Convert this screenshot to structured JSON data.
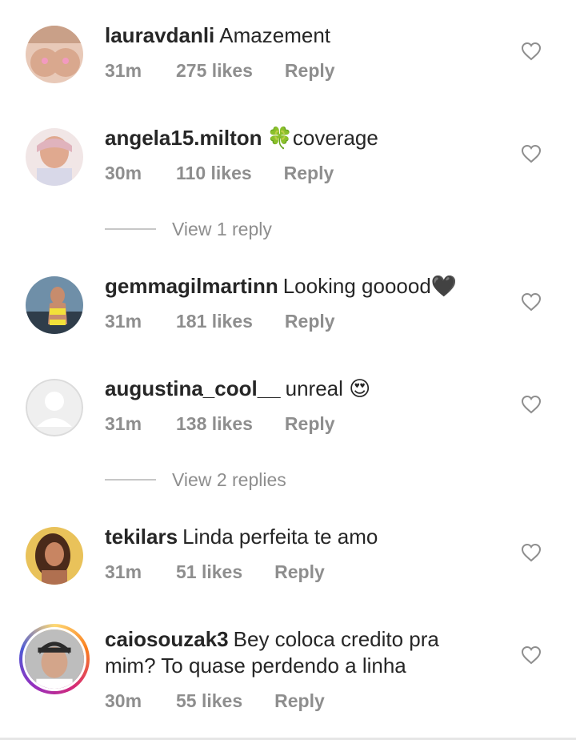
{
  "comments": [
    {
      "username": "lauravdanli",
      "text": "Amazement",
      "time": "31m",
      "likes": "275 likes",
      "reply": "Reply",
      "avatar": "avatar-photo"
    },
    {
      "username": "angela15.milton",
      "text": "🍀coverage",
      "time": "30m",
      "likes": "110 likes",
      "reply": "Reply",
      "avatar": "avatar-photo"
    },
    {
      "username": "gemmagilmartinn",
      "text": "Looking gooood🖤",
      "time": "31m",
      "likes": "181 likes",
      "reply": "Reply",
      "avatar": "avatar-photo"
    },
    {
      "username": "augustina_cool__",
      "text": "unreal 😍",
      "time": "31m",
      "likes": "138 likes",
      "reply": "Reply",
      "avatar": "default-avatar"
    },
    {
      "username": "tekilars",
      "text": "Linda perfeita te amo",
      "time": "31m",
      "likes": "51 likes",
      "reply": "Reply",
      "avatar": "avatar-photo"
    },
    {
      "username": "caiosouzak3",
      "text": "Bey coloca credito pra mim? To quase perdendo a linha",
      "time": "30m",
      "likes": "55 likes",
      "reply": "Reply",
      "avatar": "avatar-photo-story-ring"
    }
  ],
  "view_replies": [
    {
      "label": "View 1 reply"
    },
    {
      "label": "View 2 replies"
    }
  ],
  "icons": {
    "like": "heart-outline-icon"
  },
  "colors": {
    "text": "#262626",
    "secondary": "#8e8e8e",
    "divider": "#c7c7c7"
  }
}
